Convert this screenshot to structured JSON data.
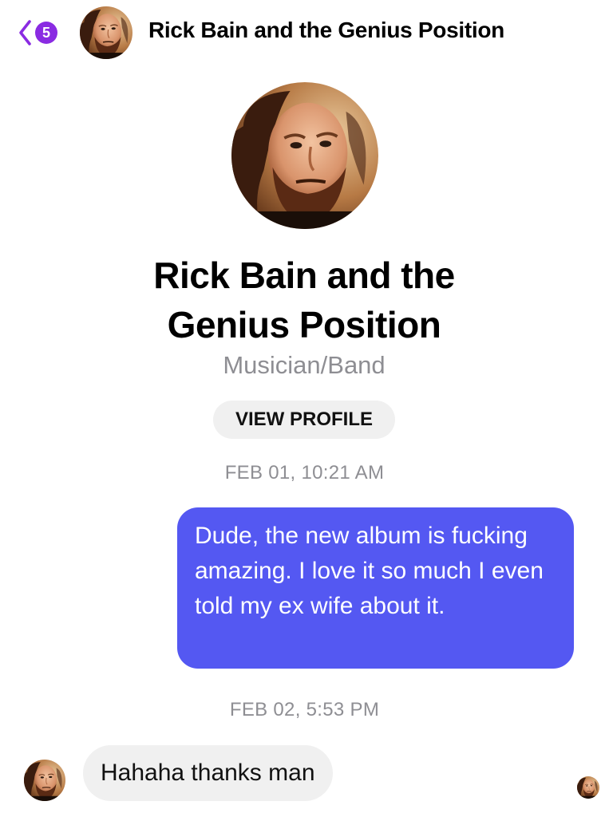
{
  "header": {
    "back_badge": "5",
    "title": "Rick Bain and the Genius Position"
  },
  "profile": {
    "name": "Rick Bain and the Genius Position",
    "category": "Musician/Band",
    "view_profile_label": "VIEW PROFILE"
  },
  "messages": [
    {
      "timestamp": "FEB 01, 10:21 AM",
      "direction": "outgoing",
      "text": "Dude, the new album is fucking amazing. I love it so much I even told my ex wife about it."
    },
    {
      "timestamp": "FEB 02, 5:53 PM",
      "direction": "incoming",
      "text": "Hahaha thanks man"
    }
  ],
  "colors": {
    "accent": "#8a2be2",
    "outgoing_bubble": "#5458f2",
    "incoming_bubble": "#f0f0f0",
    "secondary_text": "#8e8e93"
  },
  "icons": {
    "back": "chevron-left-icon",
    "avatar": "contact-avatar"
  }
}
